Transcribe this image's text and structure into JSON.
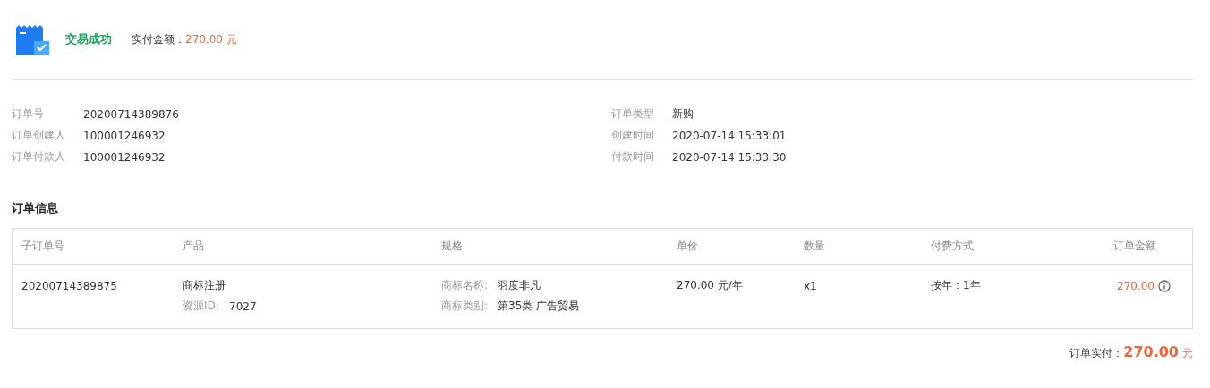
{
  "status": {
    "title": "交易成功",
    "paid_label": "实付金额：",
    "paid_amount": "270.00 元"
  },
  "details": {
    "left": [
      {
        "label": "订单号",
        "value": "20200714389876"
      },
      {
        "label": "订单创建人",
        "value": "100001246932"
      },
      {
        "label": "订单付款人",
        "value": "100001246932"
      }
    ],
    "right": [
      {
        "label": "订单类型",
        "value": "新购"
      },
      {
        "label": "创建时间",
        "value": "2020-07-14 15:33:01"
      },
      {
        "label": "付款时间",
        "value": "2020-07-14 15:33:30"
      }
    ]
  },
  "section_title": "订单信息",
  "table": {
    "columns": [
      "子订单号",
      "产品",
      "规格",
      "单价",
      "数量",
      "付费方式",
      "订单金额"
    ],
    "rows": [
      {
        "sub_order": "20200714389875",
        "product": "商标注册",
        "resource_label": "资源ID:",
        "resource_id": "7027",
        "specs": [
          {
            "label": "商标名称:",
            "value": "羽度非凡"
          },
          {
            "label": "商标类别:",
            "value": "第35类 广告贸易"
          }
        ],
        "unit_price": "270.00 元/年",
        "quantity": "x1",
        "billing": "按年：1年",
        "amount": "270.00"
      }
    ]
  },
  "total": {
    "label": "订单实付：",
    "amount": "270.00",
    "unit": "元"
  }
}
